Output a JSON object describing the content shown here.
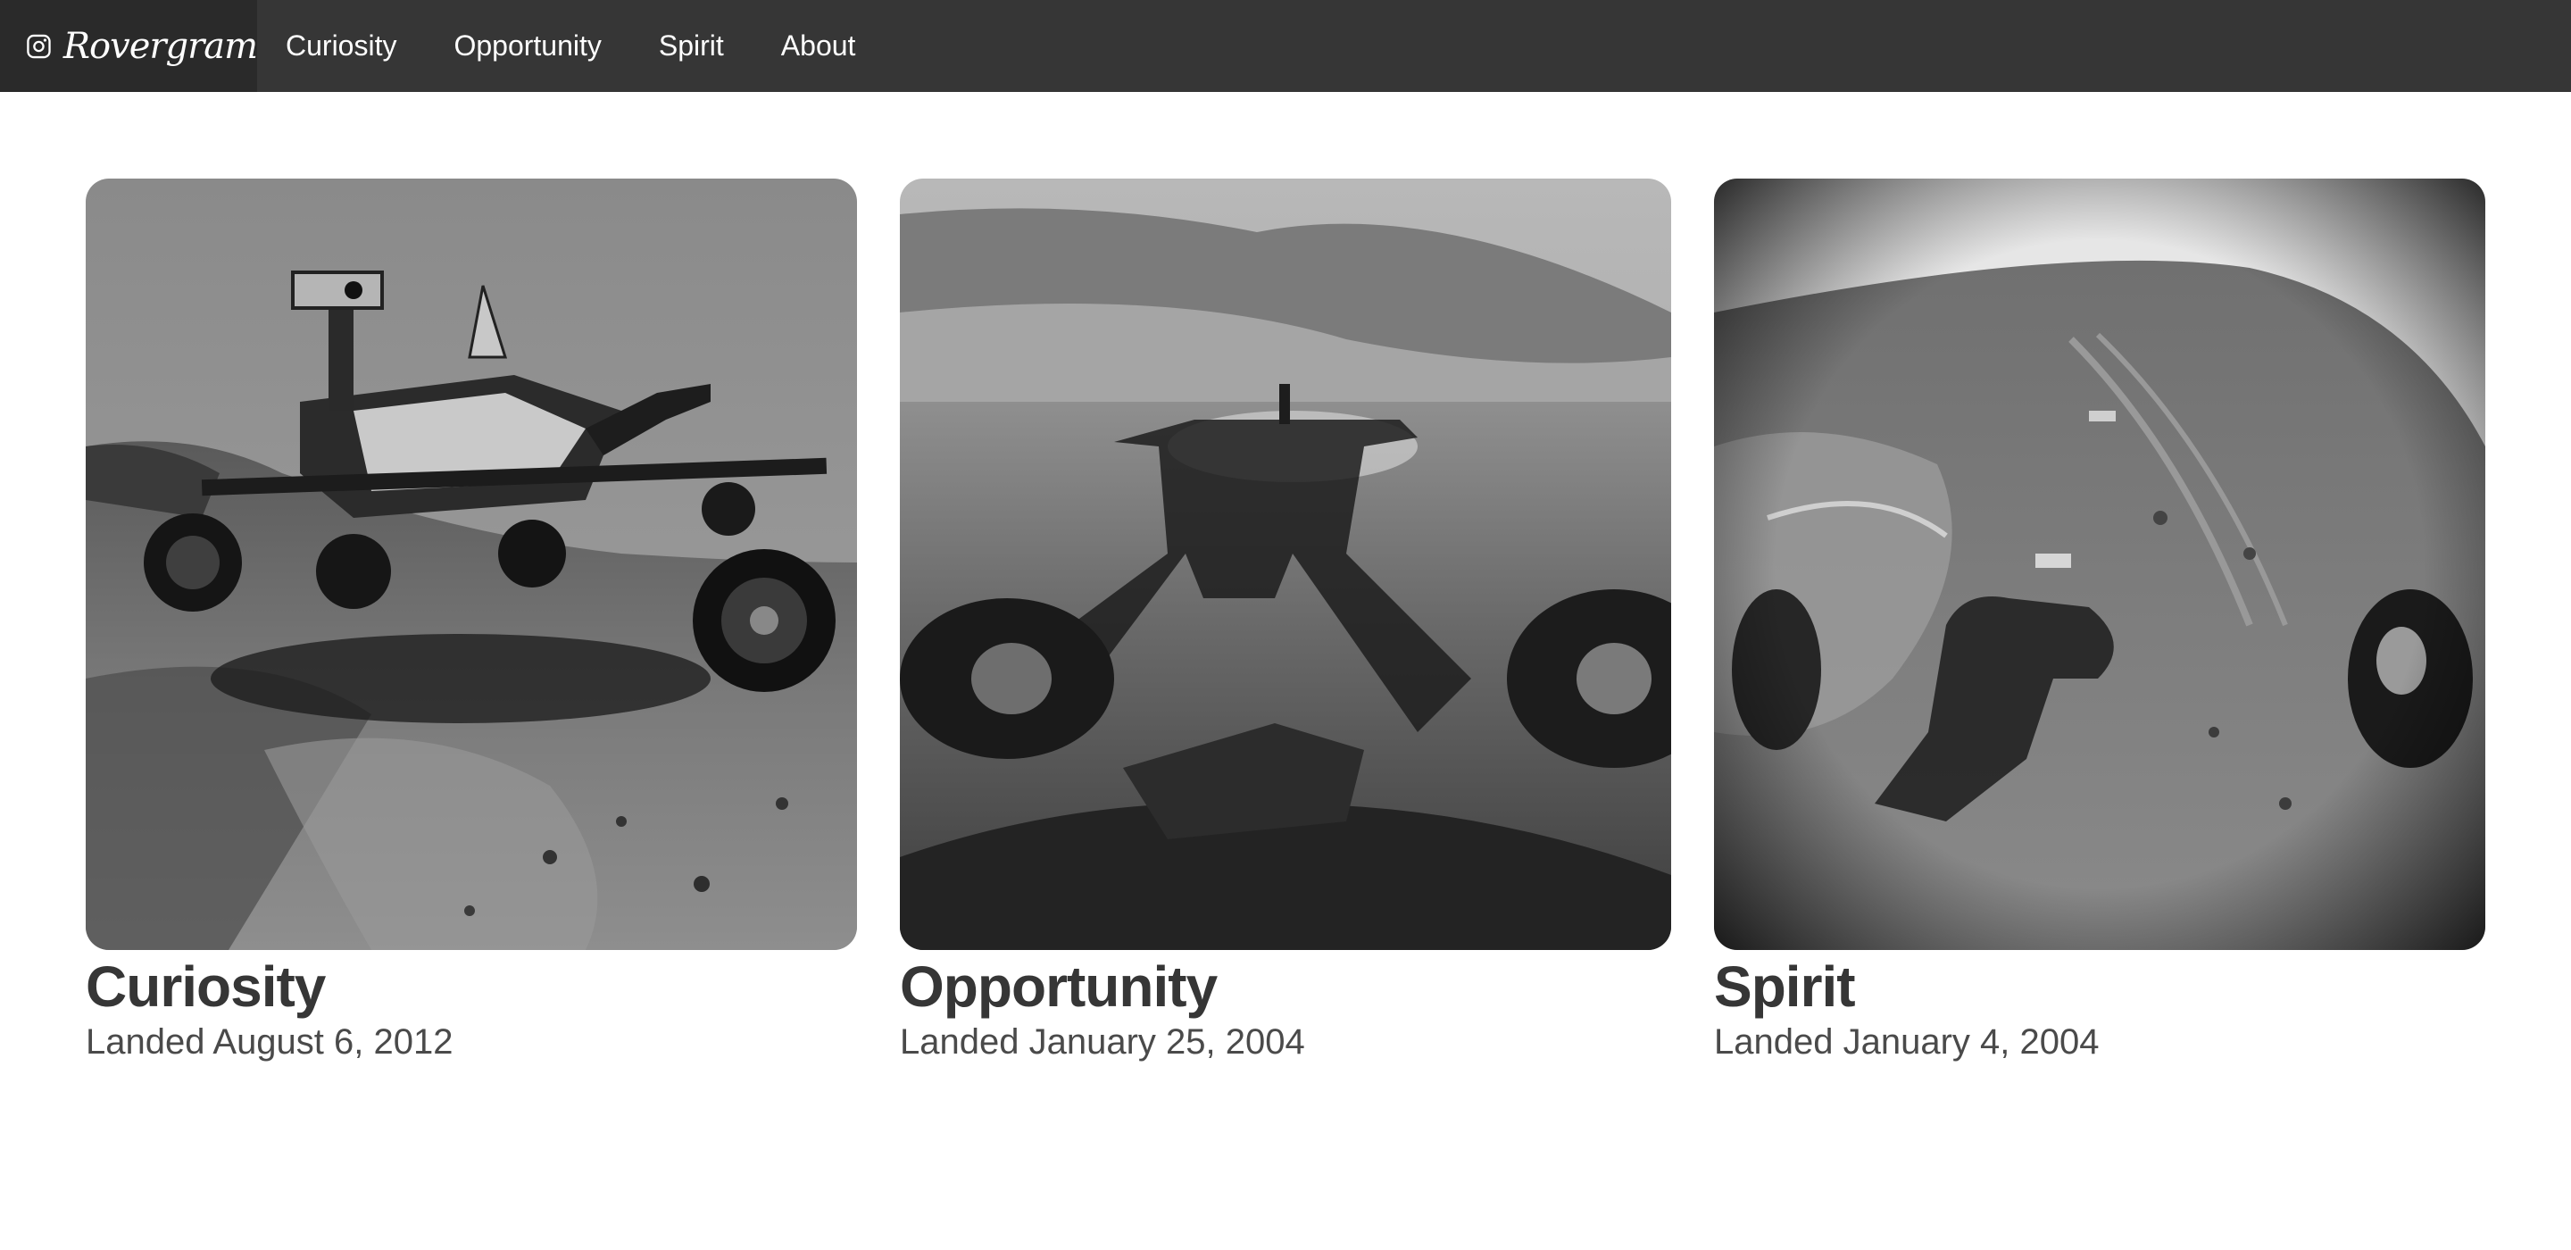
{
  "nav": {
    "brand": {
      "name": "Rovergram",
      "icon": "camera-icon"
    },
    "links": [
      {
        "label": "Curiosity"
      },
      {
        "label": "Opportunity"
      },
      {
        "label": "Spirit"
      },
      {
        "label": "About"
      }
    ]
  },
  "colors": {
    "navbar": "#363636",
    "brand_bg": "#2a2a2a",
    "text": "#363636"
  },
  "rovers": [
    {
      "name": "Curiosity",
      "landed": "Landed August 6, 2012",
      "image": "curiosity-rover-photo"
    },
    {
      "name": "Opportunity",
      "landed": "Landed January 25, 2004",
      "image": "opportunity-shadow-photo"
    },
    {
      "name": "Spirit",
      "landed": "Landed January 4, 2004",
      "image": "spirit-terrain-photo"
    }
  ]
}
